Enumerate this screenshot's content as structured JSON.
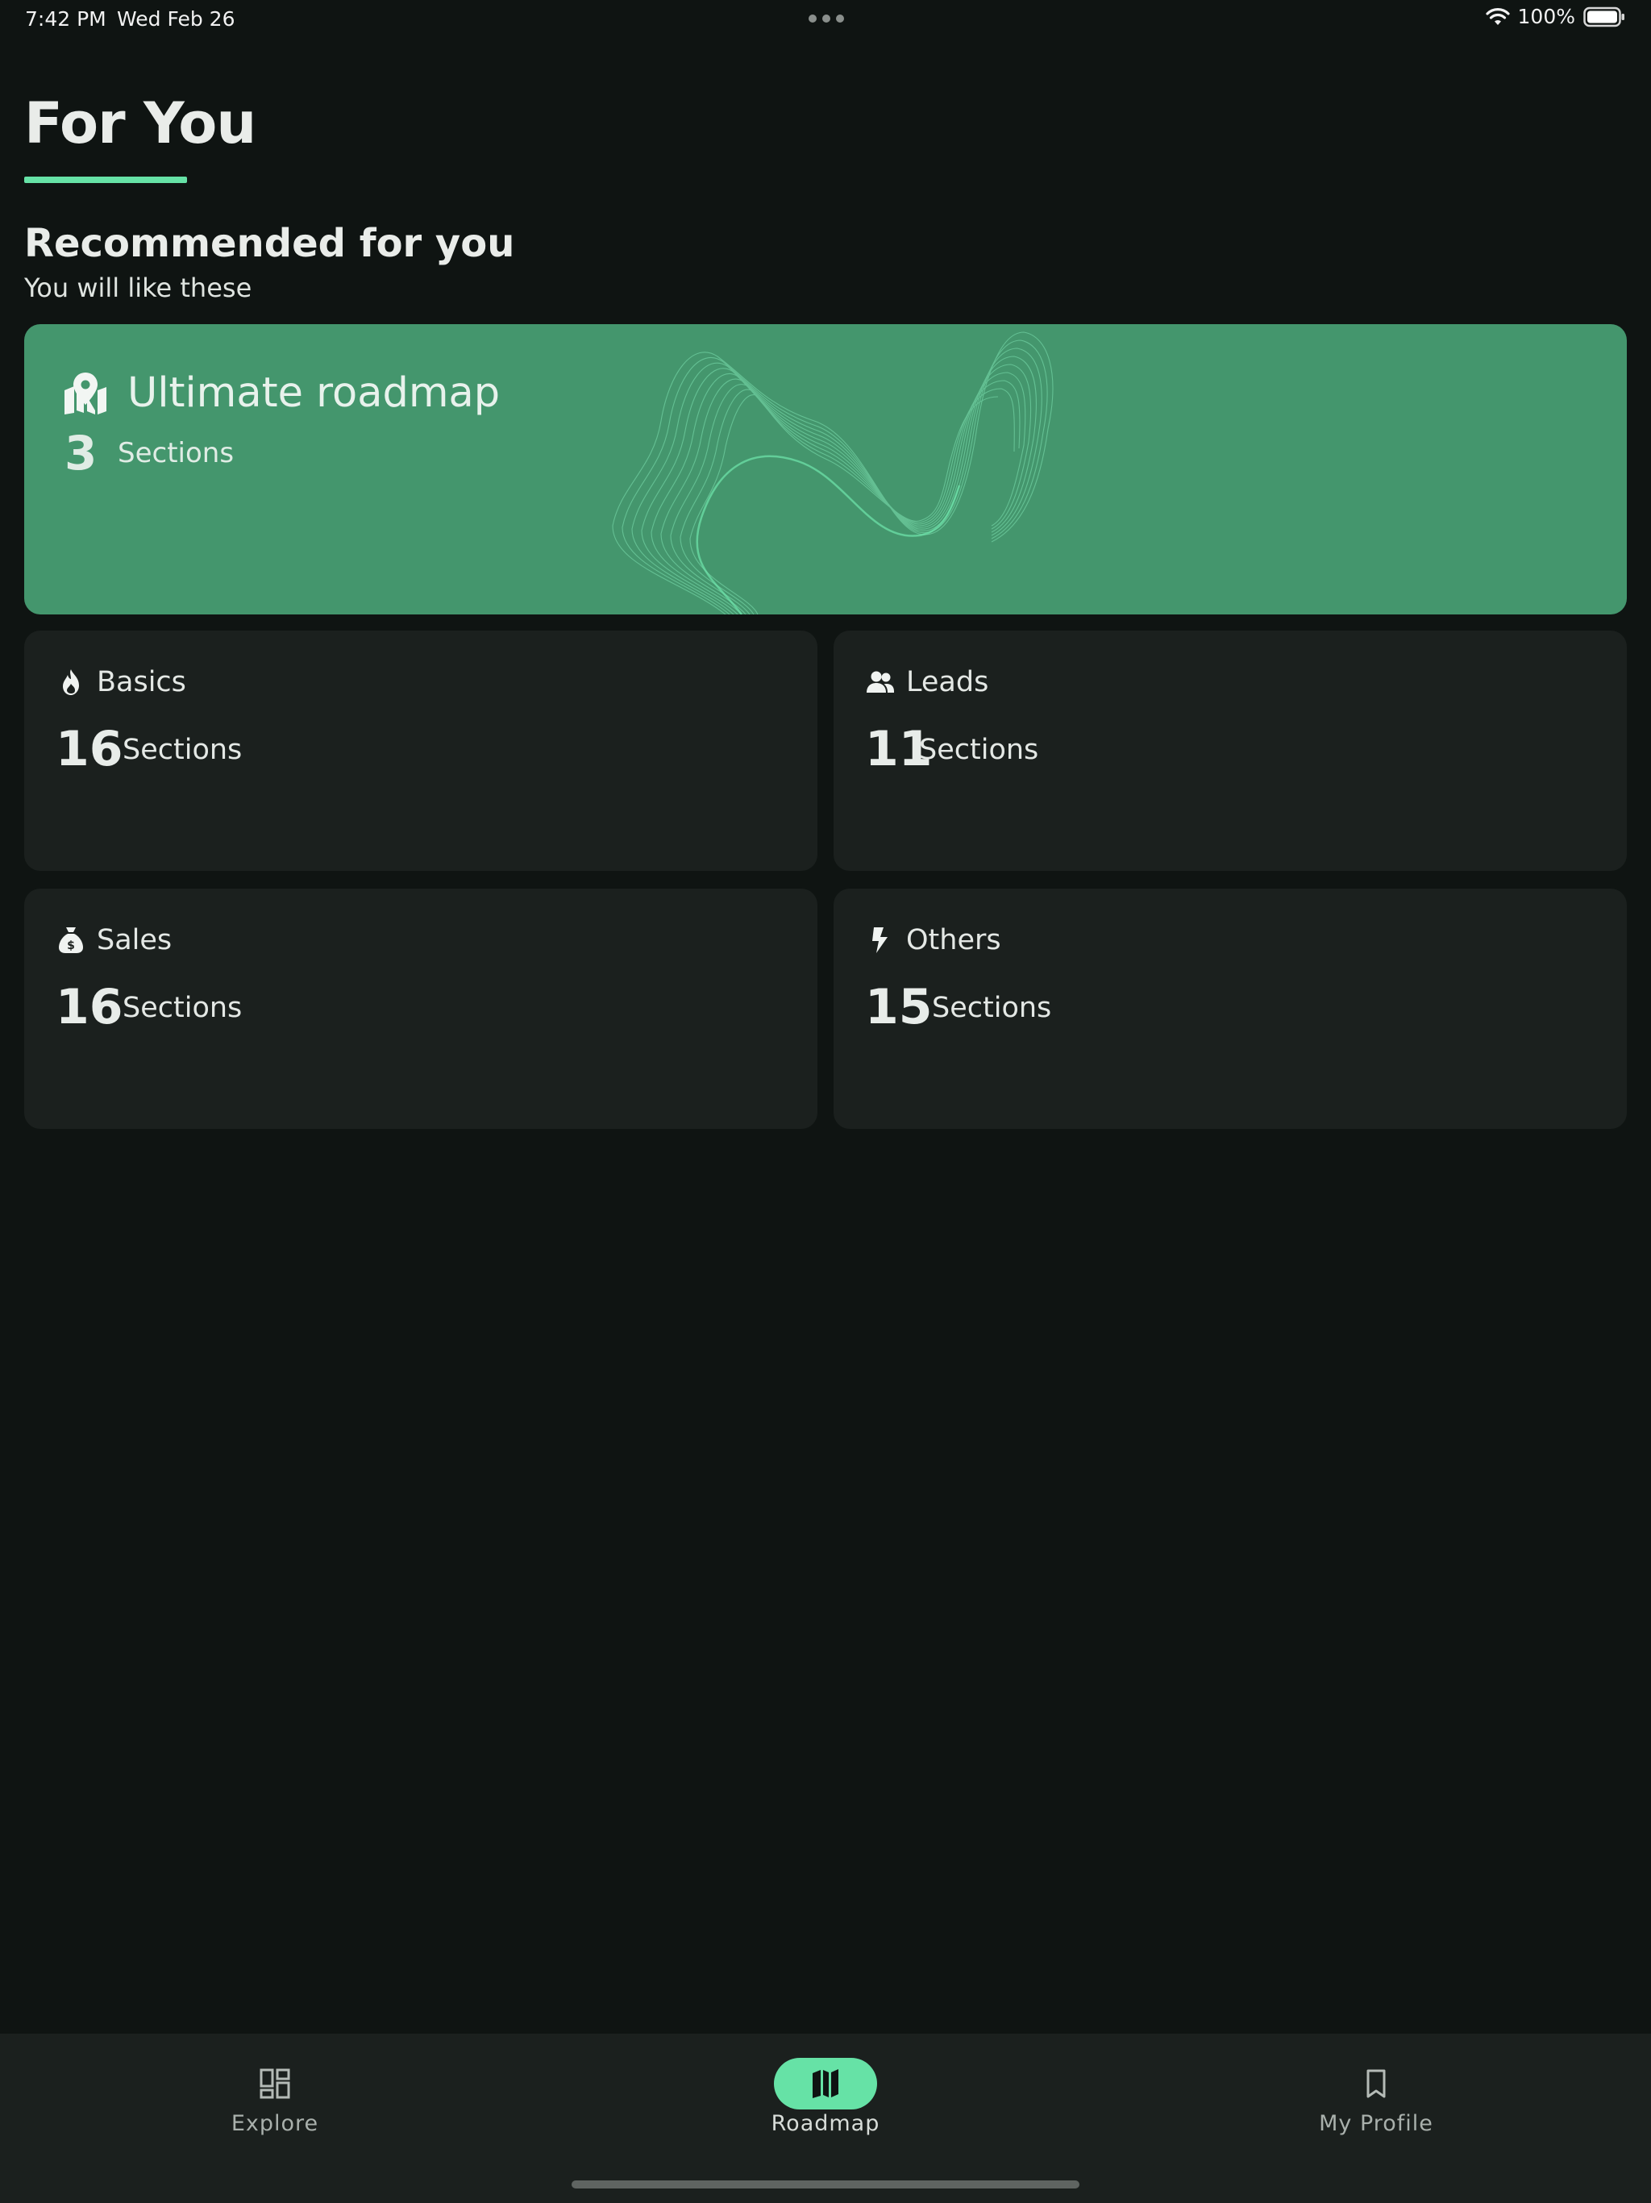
{
  "status_bar": {
    "time": "7:42 PM",
    "date": "Wed Feb 26",
    "battery": "100%"
  },
  "header": {
    "title": "For You"
  },
  "recommended": {
    "title": "Recommended for you",
    "subtitle": "You will like these"
  },
  "featured": {
    "icon": "map-pin-icon",
    "title": "Ultimate roadmap",
    "count": "3",
    "count_label": "Sections",
    "background": "#44966d"
  },
  "categories": [
    {
      "icon": "flame-icon",
      "label": "Basics",
      "count": "16",
      "count_label": "Sections"
    },
    {
      "icon": "users-icon",
      "label": "Leads",
      "count": "11",
      "count_label": "Sections"
    },
    {
      "icon": "money-bag-icon",
      "label": "Sales",
      "count": "16",
      "count_label": "Sections"
    },
    {
      "icon": "bolt-icon",
      "label": "Others",
      "count": "15",
      "count_label": "Sections"
    }
  ],
  "bottom_nav": {
    "items": [
      {
        "icon": "dashboard-icon",
        "label": "Explore",
        "active": false
      },
      {
        "icon": "map-icon",
        "label": "Roadmap",
        "active": true
      },
      {
        "icon": "bookmark-icon",
        "label": "My Profile",
        "active": false
      }
    ],
    "accent": "#66e2a6"
  }
}
